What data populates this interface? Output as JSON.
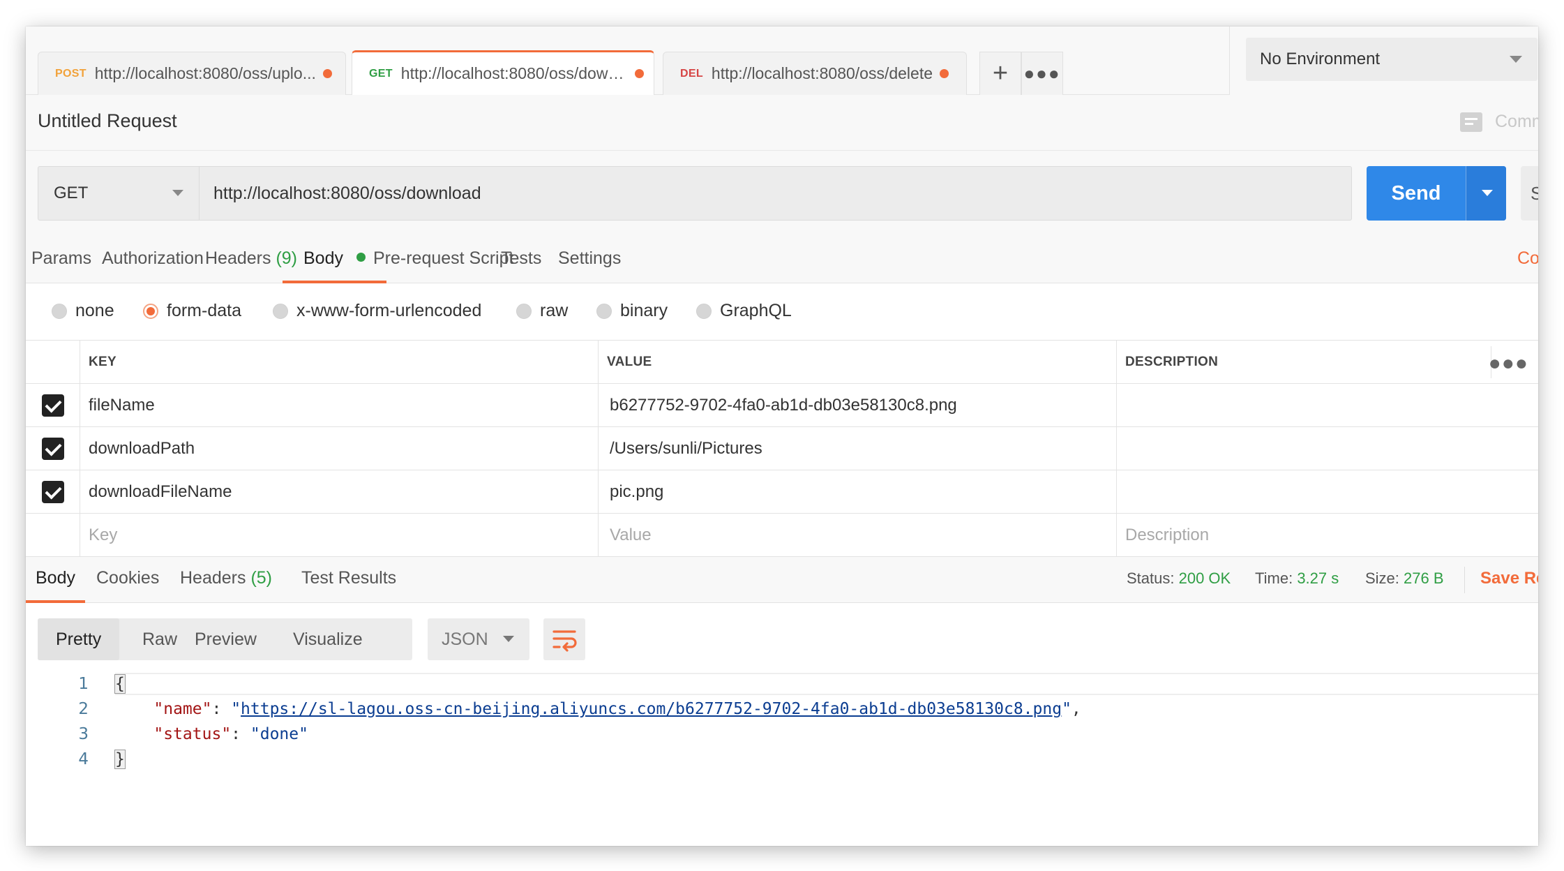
{
  "tabs": [
    {
      "method": "POST",
      "method_color": "#f2a23a",
      "url": "http://localhost:8080/oss/uplo..."
    },
    {
      "method": "GET",
      "method_color": "#2f9e44",
      "url": "http://localhost:8080/oss/down..."
    },
    {
      "method": "DEL",
      "method_color": "#d64545",
      "url": "http://localhost:8080/oss/delete"
    }
  ],
  "environment": {
    "selected": "No Environment"
  },
  "request": {
    "name": "Untitled Request",
    "comments_label": "Comm",
    "method": "GET",
    "url": "http://localhost:8080/oss/download",
    "send_label": "Send",
    "save_stub": "S"
  },
  "request_tabs": {
    "params": "Params",
    "authorization": "Authorization",
    "headers": "Headers",
    "headers_count": "(9)",
    "body": "Body",
    "pre_request": "Pre-request Script",
    "tests": "Tests",
    "settings": "Settings",
    "cookies": "Co"
  },
  "body_types": [
    "none",
    "form-data",
    "x-www-form-urlencoded",
    "raw",
    "binary",
    "GraphQL"
  ],
  "params_table": {
    "headers": {
      "key": "KEY",
      "value": "VALUE",
      "description": "DESCRIPTION"
    },
    "rows": [
      {
        "key": "fileName",
        "value": "b6277752-9702-4fa0-ab1d-db03e58130c8.png",
        "description": ""
      },
      {
        "key": "downloadPath",
        "value": "/Users/sunli/Pictures",
        "description": ""
      },
      {
        "key": "downloadFileName",
        "value": "pic.png",
        "description": ""
      }
    ],
    "placeholders": {
      "key": "Key",
      "value": "Value",
      "description": "Description"
    }
  },
  "response_tabs": {
    "body": "Body",
    "cookies": "Cookies",
    "headers": "Headers",
    "headers_count": "(5)",
    "test_results": "Test Results"
  },
  "response_meta": {
    "status_label": "Status:",
    "status": "200 OK",
    "time_label": "Time:",
    "time": "3.27 s",
    "size_label": "Size:",
    "size": "276 B",
    "save_label": "Save Re"
  },
  "response_view": {
    "modes": [
      "Pretty",
      "Raw",
      "Preview",
      "Visualize"
    ],
    "format": "JSON"
  },
  "response_body": {
    "line_numbers": [
      "1",
      "2",
      "3",
      "4"
    ],
    "open_brace": "{",
    "close_brace": "}",
    "name_key": "\"name\"",
    "name_value": "https://sl-lagou.oss-cn-beijing.aliyuncs.com/b6277752-9702-4fa0-ab1d-db03e58130c8.png",
    "status_key": "\"status\"",
    "status_value": "\"done\""
  },
  "colors": {
    "accent": "#f26b3a",
    "send": "#2f88e8",
    "success": "#2f9e44"
  }
}
